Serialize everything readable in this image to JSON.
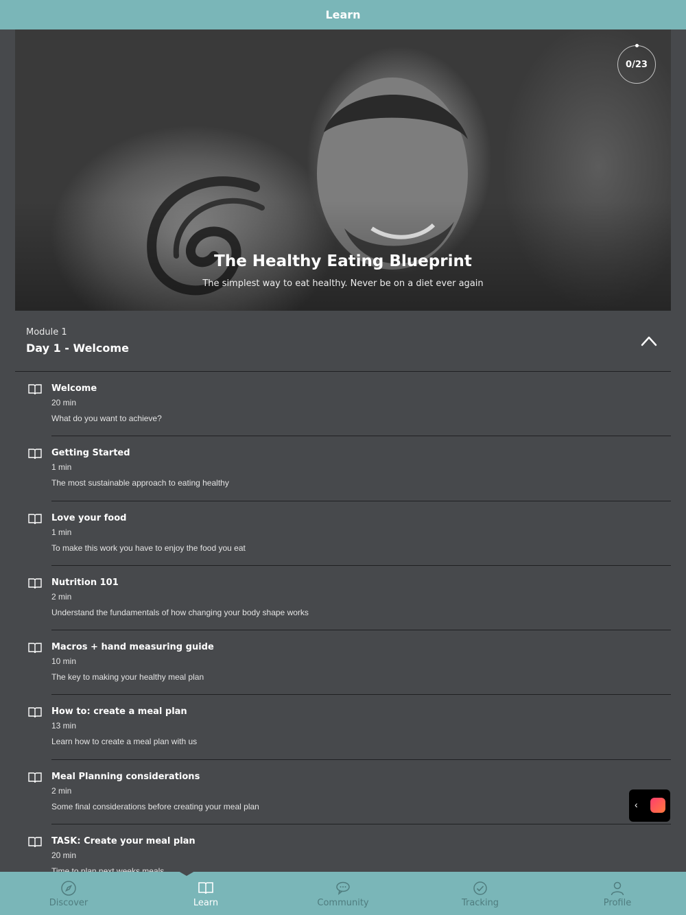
{
  "header": {
    "title": "Learn"
  },
  "hero": {
    "title": "The Healthy Eating Blueprint",
    "subtitle": "The simplest way to eat healthy. Never be on a diet ever again",
    "progress": "0/23"
  },
  "module": {
    "label": "Module  1",
    "title": "Day 1 -  Welcome"
  },
  "lessons": [
    {
      "title": "Welcome",
      "duration": "20 min",
      "description": "What do you want to achieve?"
    },
    {
      "title": "Getting Started",
      "duration": "1 min",
      "description": "The most sustainable approach to eating healthy"
    },
    {
      "title": "Love your food",
      "duration": "1 min",
      "description": "To make this work you have to enjoy the food you eat"
    },
    {
      "title": "Nutrition 101",
      "duration": "2 min",
      "description": "Understand the fundamentals of how changing your body shape works"
    },
    {
      "title": "Macros + hand measuring guide",
      "duration": "10 min",
      "description": "The key to making your healthy meal plan"
    },
    {
      "title": "How to: create a meal plan",
      "duration": "13 min",
      "description": "Learn how to create a meal plan with us"
    },
    {
      "title": "Meal Planning considerations",
      "duration": "2 min",
      "description": "Some final considerations before creating your meal plan"
    },
    {
      "title": "TASK: Create your meal plan",
      "duration": "20 min",
      "description": "Time to plan next weeks meals"
    }
  ],
  "floating": {
    "arrow": "‹"
  },
  "tabs": [
    {
      "label": "Discover",
      "icon": "compass-icon"
    },
    {
      "label": "Learn",
      "icon": "book-icon",
      "active": true
    },
    {
      "label": "Community",
      "icon": "chat-bubbles-icon"
    },
    {
      "label": "Tracking",
      "icon": "check-circle-icon"
    },
    {
      "label": "Profile",
      "icon": "person-icon"
    }
  ],
  "colors": {
    "accent": "#7ab6b8",
    "background": "#47494c",
    "tab_inactive": "#4f7c7e"
  }
}
